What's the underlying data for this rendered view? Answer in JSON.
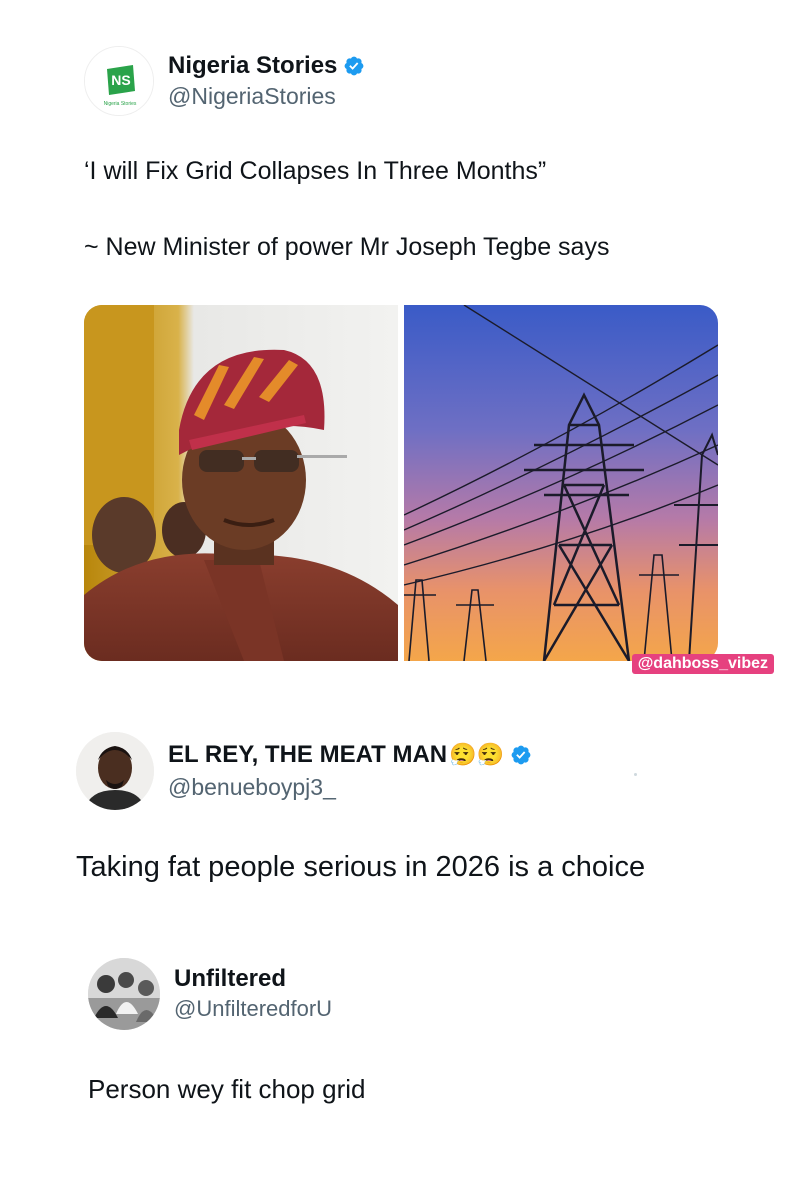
{
  "posts": [
    {
      "display_name": "Nigeria Stories",
      "handle": "@NigeriaStories",
      "verified": true,
      "avatar_text": "NS",
      "avatar_subtext": "Nigeria Stories",
      "lines": [
        "‘I will Fix Grid Collapses In Three Months”",
        "~ New Minister of power Mr Joseph Tegbe says"
      ],
      "media": {
        "count": 2,
        "watermark": "@dahboss_vibez"
      }
    },
    {
      "display_name": "EL REY, THE MEAT MAN",
      "emoji": "😮‍💨😮‍💨",
      "handle": "@benueboypj3_",
      "verified": true,
      "lines": [
        "Taking fat people serious in 2026 is a choice"
      ]
    },
    {
      "display_name": "Unfiltered",
      "handle": "@UnfilteredforU",
      "verified": false,
      "lines": [
        "Person wey fit chop grid"
      ]
    }
  ],
  "colors": {
    "text": "#0f1419",
    "handle": "#536471",
    "verified": "#1d9bf0",
    "ns_green": "#2aa34a",
    "watermark_bg": "#e6417f"
  },
  "icons": {
    "verified": "verified-badge-icon"
  }
}
